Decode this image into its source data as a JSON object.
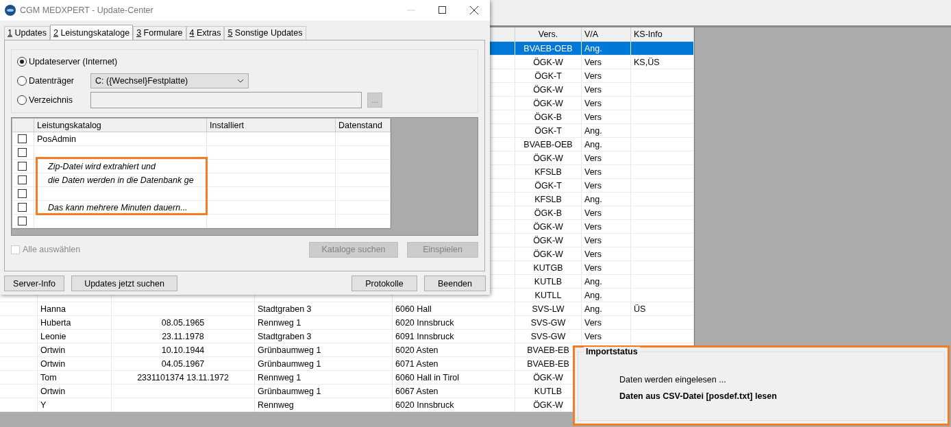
{
  "table": {
    "columns": [
      "Vers.",
      "V/A",
      "KS-Info"
    ],
    "rows": [
      {
        "vers": "BVAEB-OEB",
        "va": "Ang.",
        "selected": true
      },
      {
        "vers": "ÖGK-W",
        "va": "Vers",
        "ks": "KS,ÜS",
        "selected": false
      },
      {
        "vers": "ÖGK-T",
        "va": "Vers",
        "selected": false
      },
      {
        "vers": "ÖGK-W",
        "va": "Vers",
        "selected": false
      },
      {
        "vers": "ÖGK-W",
        "va": "Vers",
        "selected": false
      },
      {
        "vers": "ÖGK-B",
        "va": "Vers",
        "selected": false
      },
      {
        "vers": "ÖGK-T",
        "va": "Ang.",
        "selected": false
      },
      {
        "vers": "BVAEB-OEB",
        "va": "Ang.",
        "selected": false
      },
      {
        "vers": "ÖGK-W",
        "va": "Vers",
        "selected": false
      },
      {
        "vers": "KFSLB",
        "va": "Vers",
        "selected": false
      },
      {
        "vers": "ÖGK-T",
        "va": "Vers",
        "selected": false
      },
      {
        "vers": "KFSLB",
        "va": "Ang.",
        "selected": false
      },
      {
        "vers": "ÖGK-B",
        "va": "Vers",
        "selected": false
      },
      {
        "vers": "ÖGK-W",
        "va": "Vers",
        "selected": false
      },
      {
        "vers": "ÖGK-W",
        "va": "Vers",
        "selected": false
      },
      {
        "vers": "ÖGK-W",
        "va": "Vers",
        "selected": false
      },
      {
        "vers": "KUTGB",
        "va": "Vers",
        "selected": false
      },
      {
        "vers": "KUTLB",
        "va": "Ang.",
        "selected": false
      },
      {
        "vers": "KUTLL",
        "va": "Ang.",
        "selected": false
      },
      {
        "name": "Hanna",
        "street": "Stadtgraben 3",
        "city": "6060 Hall",
        "vers": "SVS-LW",
        "va": "Ang.",
        "ks": "ÜS",
        "selected": false
      },
      {
        "name": "Huberta",
        "dob": "08.05.1965",
        "street": "Rennweg 1",
        "city": "6020 Innsbruck",
        "vers": "SVS-GW",
        "va": "Vers",
        "selected": false
      },
      {
        "name": "Leonie",
        "dob": "23.11.1978",
        "street": "Stadtgraben 3",
        "city": "6091 Innsbruck",
        "vers": "SVS-GW",
        "va": "Vers",
        "selected": false
      },
      {
        "name": "Ortwin",
        "dob": "10.10.1944",
        "street": "Grünbaumweg 1",
        "city": "6020 Asten",
        "vers": "BVAEB-EB",
        "selected": false
      },
      {
        "name": "Ortwin",
        "dob": "04.05.1967",
        "street": "Grünbaumweg 1",
        "city": "6071 Asten",
        "vers": "BVAEB-EB",
        "selected": false
      },
      {
        "name": "Tom",
        "dob": "2331101374 13.11.1972",
        "street": "Rennweg 1",
        "city": "6060 Hall in Tirol",
        "vers": "ÖGK-W",
        "selected": false
      },
      {
        "name": "Ortwin",
        "street": "Grünbaumweg 1",
        "city": "6067 Asten",
        "vers": "KUTLB",
        "selected": false
      },
      {
        "name": "Y",
        "street": "Rennweg",
        "city": "6020 Innsbruck",
        "vers": "ÖGK-W",
        "selected": false
      }
    ]
  },
  "dialog": {
    "title": "CGM MEDXPERT - Update-Center",
    "tabs": [
      {
        "label": "1 Updates",
        "selected": false
      },
      {
        "label": "2 Leistungskataloge",
        "selected": true
      },
      {
        "label": "3 Formulare",
        "selected": false
      },
      {
        "label": "4 Extras",
        "selected": false
      },
      {
        "label": "5 Sonstige Updates",
        "selected": false
      }
    ],
    "sources": [
      {
        "kind": "plain",
        "label": "Updateserver (Internet)",
        "selected": true
      },
      {
        "kind": "dropdown",
        "label": "Datenträger",
        "selected": false,
        "value": "C: ({Wechsel}Festplatte)"
      },
      {
        "kind": "path",
        "label": "Verzeichnis",
        "selected": false,
        "browse": "..."
      }
    ],
    "catalog": {
      "columns": [
        "Leistungskatalog",
        "Installiert",
        "Datenstand"
      ],
      "rows": [
        {
          "name": "PosAdmin",
          "checked": false
        },
        {
          "checked": false
        },
        {
          "checked": false,
          "message": "Zip-Datei wird extrahiert und"
        },
        {
          "checked": false,
          "message": "die Daten werden in die Datenbank ge"
        },
        {
          "checked": false
        },
        {
          "checked": false,
          "message": "Das kann mehrere Minuten dauern..."
        },
        {
          "checked": false
        }
      ]
    },
    "select_all": {
      "label": "Alle auswählen",
      "checked": false,
      "disabled": true
    },
    "panel_buttons": [
      {
        "label": "Kataloge suchen",
        "disabled": true
      },
      {
        "label": "Einspielen",
        "disabled": true
      }
    ],
    "left_buttons": [
      "Server-Info",
      "Updates jetzt suchen"
    ],
    "right_buttons": [
      "Protokolle",
      "Beenden"
    ]
  },
  "import_status": {
    "title": "Importstatus",
    "message": "Daten werden eingelesen ...",
    "detail": "Daten aus CSV-Datei [posdef.txt] lesen"
  }
}
